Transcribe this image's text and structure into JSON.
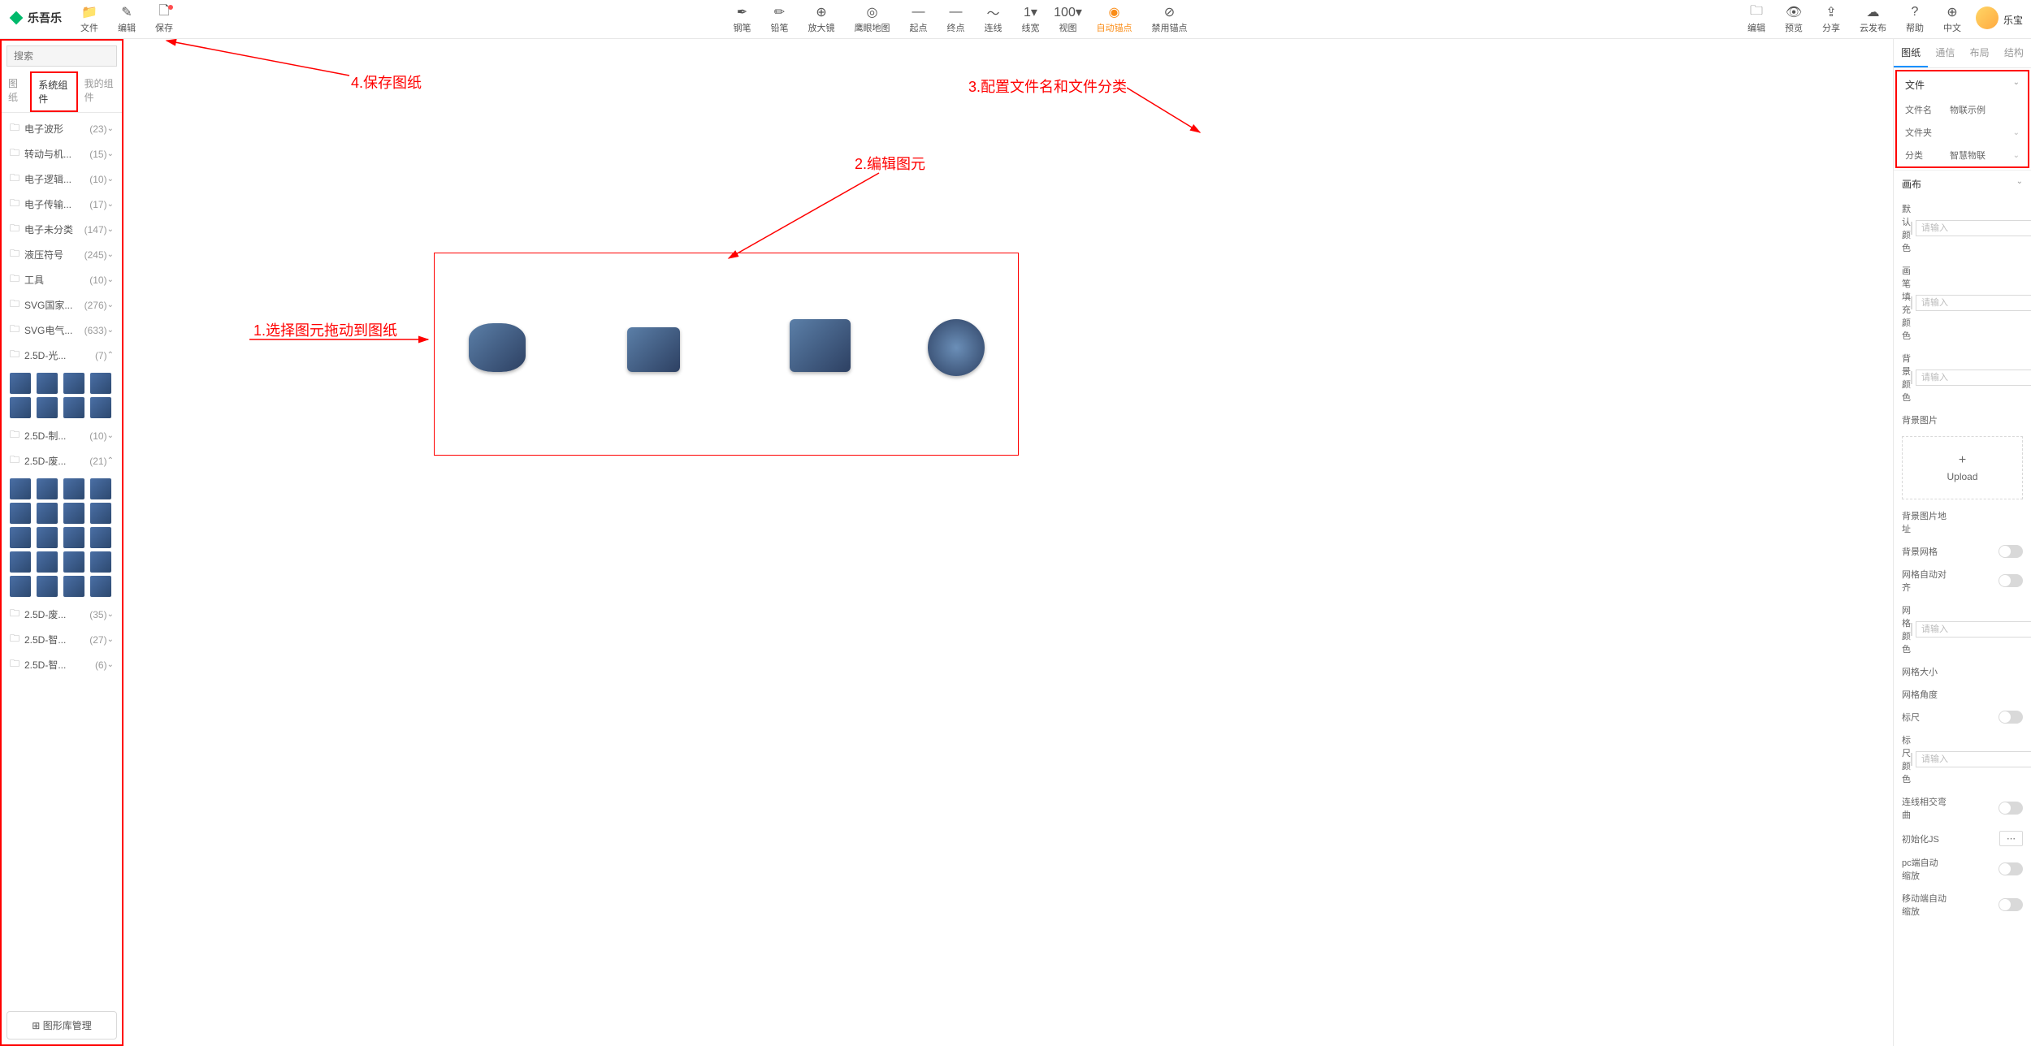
{
  "brand": "乐吾乐",
  "user": "乐宝",
  "toolbar_left": [
    {
      "icon": "📁",
      "label": "文件",
      "name": "file"
    },
    {
      "icon": "✎",
      "label": "编辑",
      "name": "edit"
    },
    {
      "icon": "🗋",
      "label": "保存",
      "name": "save",
      "badge": true
    }
  ],
  "toolbar_center": [
    {
      "icon": "✒",
      "label": "钢笔",
      "name": "pen"
    },
    {
      "icon": "✏",
      "label": "铅笔",
      "name": "pencil"
    },
    {
      "icon": "⊕",
      "label": "放大镜",
      "name": "magnifier"
    },
    {
      "icon": "◎",
      "label": "鹰眼地图",
      "name": "minimap"
    },
    {
      "icon": "—",
      "label": "起点",
      "name": "start"
    },
    {
      "icon": "—",
      "label": "终点",
      "name": "end"
    },
    {
      "icon": "〜",
      "label": "连线",
      "name": "line"
    },
    {
      "icon": "1▾",
      "label": "线宽",
      "name": "lineWidth"
    },
    {
      "icon": "100▾",
      "label": "视图",
      "name": "zoom"
    },
    {
      "icon": "◉",
      "label": "自动锚点",
      "name": "autoAnchor",
      "active": true
    },
    {
      "icon": "⊘",
      "label": "禁用锚点",
      "name": "disableAnchor"
    }
  ],
  "toolbar_right": [
    {
      "icon": "🗀",
      "label": "编辑",
      "name": "edit2"
    },
    {
      "icon": "👁",
      "label": "预览",
      "name": "preview"
    },
    {
      "icon": "⇪",
      "label": "分享",
      "name": "share"
    },
    {
      "icon": "☁",
      "label": "云发布",
      "name": "cloudPublish"
    },
    {
      "icon": "?",
      "label": "帮助",
      "name": "help"
    },
    {
      "icon": "⊕",
      "label": "中文",
      "name": "lang"
    }
  ],
  "search_placeholder": "搜索",
  "left_tabs": [
    "图纸",
    "系统组件",
    "我的组件"
  ],
  "left_active_tab": 1,
  "tree": [
    {
      "label": "电子波形",
      "count": "(23)",
      "expanded": false
    },
    {
      "label": "转动与机...",
      "count": "(15)",
      "expanded": false
    },
    {
      "label": "电子逻辑...",
      "count": "(10)",
      "expanded": false
    },
    {
      "label": "电子传输...",
      "count": "(17)",
      "expanded": false
    },
    {
      "label": "电子未分类",
      "count": "(147)",
      "expanded": false
    },
    {
      "label": "液压符号",
      "count": "(245)",
      "expanded": false
    },
    {
      "label": "工具",
      "count": "(10)",
      "expanded": false
    },
    {
      "label": "SVG国家...",
      "count": "(276)",
      "expanded": false
    },
    {
      "label": "SVG电气...",
      "count": "(633)",
      "expanded": false
    },
    {
      "label": "2.5D-光...",
      "count": "(7)",
      "expanded": true,
      "thumbs": 8
    },
    {
      "label": "2.5D-制...",
      "count": "(10)",
      "expanded": false
    },
    {
      "label": "2.5D-废...",
      "count": "(21)",
      "expanded": true,
      "thumbs": 20
    },
    {
      "label": "2.5D-废...",
      "count": "(35)",
      "expanded": false
    },
    {
      "label": "2.5D-智...",
      "count": "(27)",
      "expanded": false
    },
    {
      "label": "2.5D-智...",
      "count": "(6)",
      "expanded": false
    }
  ],
  "lib_manage": "图形库管理",
  "annotations": {
    "a1": "1.选择图元拖动到图纸",
    "a2": "2.编辑图元",
    "a3": "3.配置文件名和文件分类",
    "a4": "4.保存图纸"
  },
  "right_tabs": [
    "图纸",
    "通信",
    "布局",
    "结构"
  ],
  "right_active_tab": 0,
  "file_section": {
    "title": "文件",
    "filename_label": "文件名",
    "filename_value": "物联示例",
    "folder_label": "文件夹",
    "category_label": "分类",
    "category_value": "智慧物联"
  },
  "canvas_section": {
    "title": "画布",
    "default_color": "默认颜色",
    "fill_color": "画笔填充颜色",
    "bg_color": "背景颜色",
    "bg_image": "背景图片",
    "upload": "Upload",
    "bg_image_url": "背景图片地址",
    "bg_grid": "背景网格",
    "grid_auto_align": "网格自动对齐",
    "grid_color": "网格颜色",
    "grid_size": "网格大小",
    "grid_angle": "网格角度",
    "ruler": "标尺",
    "ruler_color": "标尺颜色",
    "line_intersect": "连线相交弯曲",
    "init_js": "初始化JS",
    "pc_auto_zoom": "pc端自动缩放",
    "mobile_auto_zoom": "移动端自动缩放",
    "input_placeholder": "请输入"
  }
}
